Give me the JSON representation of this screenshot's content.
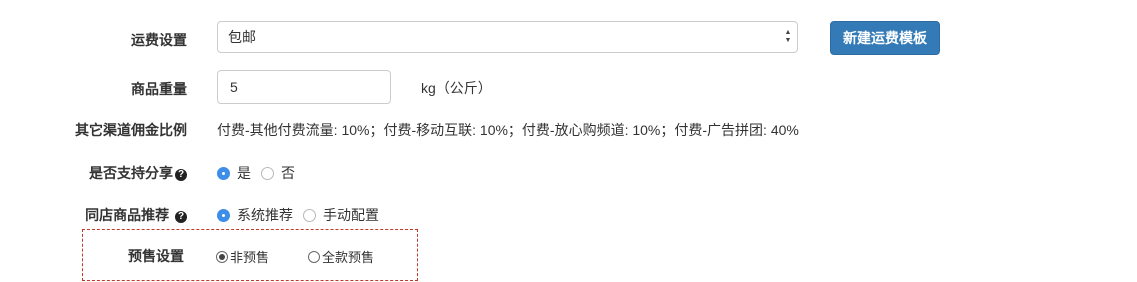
{
  "shipping": {
    "label": "运费设置",
    "selected": "包邮",
    "new_template_button": "新建运费模板"
  },
  "weight": {
    "label": "商品重量",
    "value": "5",
    "unit": "kg（公斤）"
  },
  "commission": {
    "label": "其它渠道佣金比例",
    "text": "付费-其他付费流量: 10%；付费-移动互联: 10%；付费-放心购频道: 10%；付费-广告拼团: 40%"
  },
  "share": {
    "label": "是否支持分享",
    "options": [
      "是",
      "否"
    ],
    "selected": "是"
  },
  "recommend": {
    "label": "同店商品推荐",
    "options": [
      "系统推荐",
      "手动配置"
    ],
    "selected": "系统推荐"
  },
  "presale": {
    "label": "预售设置",
    "options": [
      "非预售",
      "全款预售"
    ],
    "selected": "非预售"
  },
  "colors": {
    "primary": "#337ab7",
    "radio_checked": "#3d8ee8",
    "highlight_border": "#c0392b"
  }
}
